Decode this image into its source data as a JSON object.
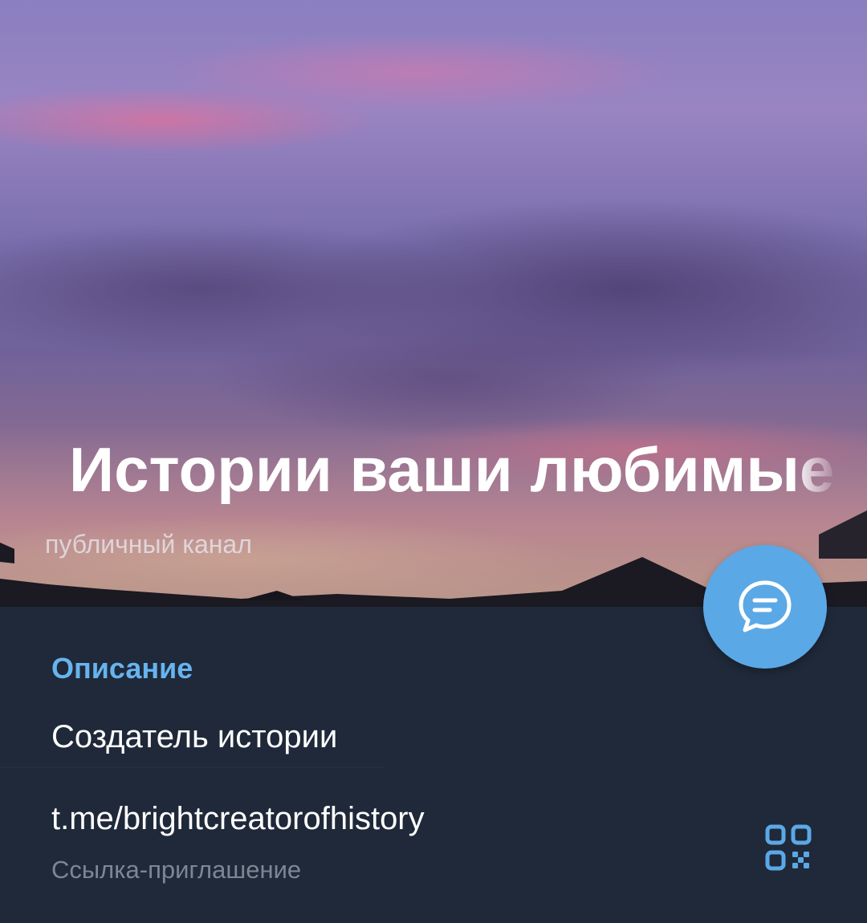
{
  "header": {
    "title": "Истории ваши любимые",
    "subtitle": "публичный канал"
  },
  "fab": {
    "icon": "chat-bubble-icon",
    "color": "#5ba8e6"
  },
  "info": {
    "section_title": "Описание",
    "description": "Создатель истории",
    "link": "t.me/brightcreatorofhistory",
    "link_caption": "Ссылка-приглашение",
    "qr_icon": "qr-code-icon"
  },
  "colors": {
    "accent": "#67b3ee",
    "background": "#1f2939",
    "secondary_text": "#7c8794"
  }
}
